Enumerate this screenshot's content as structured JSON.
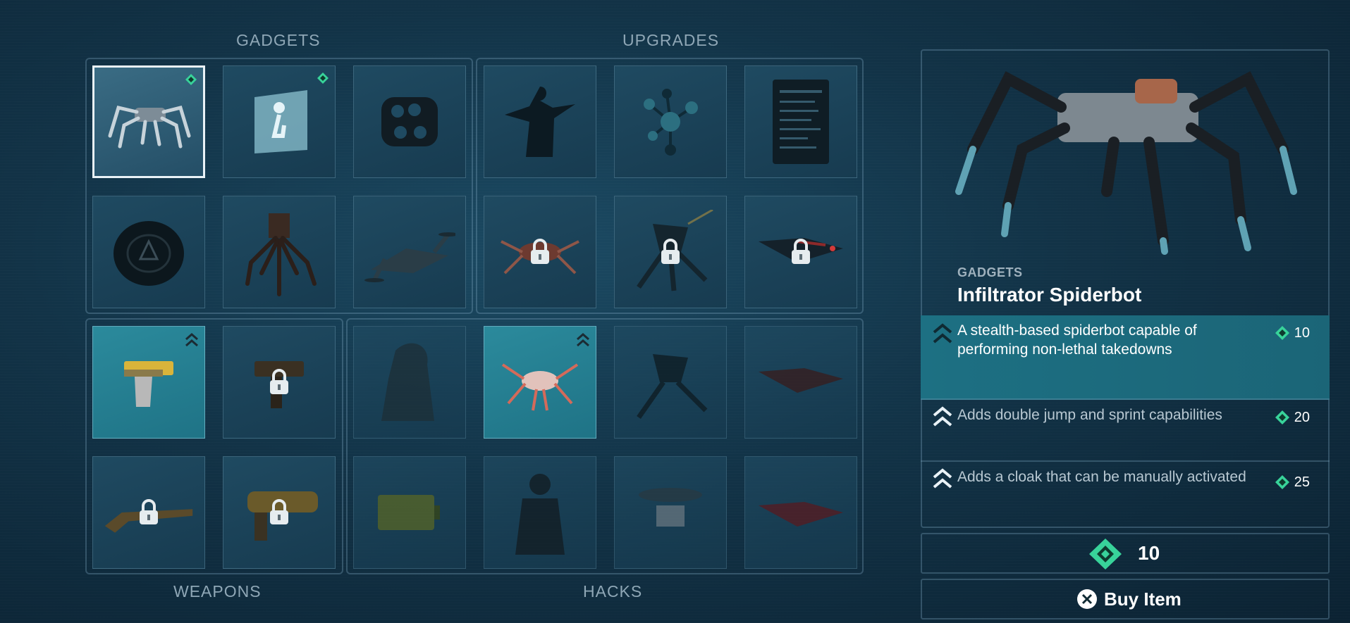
{
  "sections": {
    "gadgets": "GADGETS",
    "upgrades": "UPGRADES",
    "weapons": "WEAPONS",
    "hacks": "HACKS"
  },
  "grid": {
    "gadgets": [
      {
        "name": "spiderbot",
        "state": "selected",
        "badge": "gem"
      },
      {
        "name": "ar-cloak",
        "state": "normal",
        "badge": "gem"
      },
      {
        "name": "brass-knuckles",
        "state": "normal"
      },
      {
        "name": "shockwave-disc",
        "state": "normal"
      },
      {
        "name": "tripod-turret",
        "state": "normal"
      },
      {
        "name": "drone",
        "state": "normal"
      }
    ],
    "upgrades": [
      {
        "name": "silhouette",
        "state": "normal"
      },
      {
        "name": "molecule",
        "state": "normal"
      },
      {
        "name": "datasheet",
        "state": "normal"
      },
      {
        "name": "spider-upgrade",
        "state": "locked"
      },
      {
        "name": "turret-upgrade",
        "state": "locked"
      },
      {
        "name": "drone-upgrade",
        "state": "locked"
      }
    ],
    "weapons": [
      {
        "name": "pistol",
        "state": "highlight",
        "badge": "chevron"
      },
      {
        "name": "smg",
        "state": "locked"
      },
      {
        "name": "shotgun",
        "state": "locked"
      },
      {
        "name": "grenade-launcher",
        "state": "locked"
      }
    ],
    "hacks": [
      {
        "name": "hack-agent",
        "state": "dim"
      },
      {
        "name": "spider-hack",
        "state": "highlight",
        "badge": "chevron"
      },
      {
        "name": "turret-hack",
        "state": "dim"
      },
      {
        "name": "drone-hack",
        "state": "dim"
      },
      {
        "name": "battery-hack",
        "state": "dim"
      },
      {
        "name": "operative-hack",
        "state": "dim"
      },
      {
        "name": "cargo-drone-hack",
        "state": "dim"
      },
      {
        "name": "red-drone-hack",
        "state": "dim"
      }
    ]
  },
  "detail": {
    "category": "GADGETS",
    "title": "Infiltrator Spiderbot",
    "upgrades": [
      {
        "text": "A stealth-based spiderbot capable of performing non-lethal takedowns",
        "cost": "10",
        "active": true
      },
      {
        "text": "Adds double jump and sprint capabilities",
        "cost": "20",
        "active": false
      },
      {
        "text": "Adds a cloak that can be manually activated",
        "cost": "25",
        "active": false
      }
    ],
    "price": "10",
    "buy_label": "Buy Item"
  },
  "colors": {
    "accent_teal": "#1d7083",
    "gem_green": "#38d39a",
    "background": "#123347"
  }
}
